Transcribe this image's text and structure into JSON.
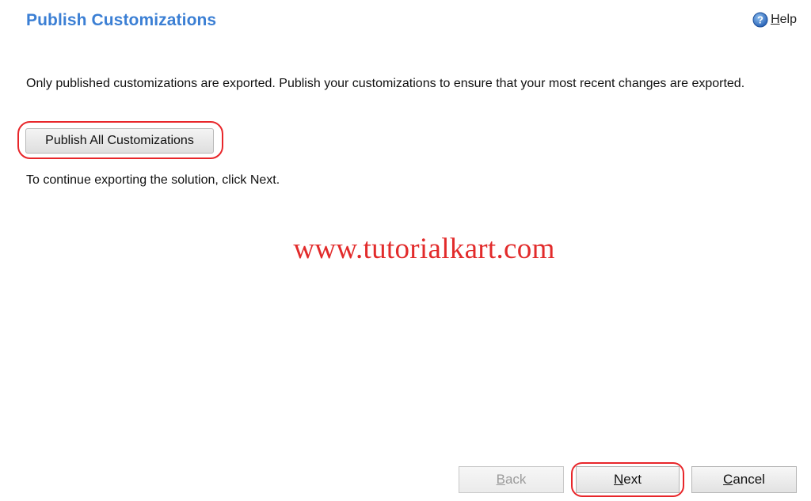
{
  "header": {
    "title": "Publish Customizations",
    "help_icon": "help-question-icon",
    "help_first_letter": "H",
    "help_rest": "elp"
  },
  "body": {
    "intro": "Only published customizations are exported. Publish your customizations to ensure that your most recent changes are exported.",
    "publish_button_label": "Publish All Customizations",
    "continue_text": "To continue exporting the solution, click Next."
  },
  "watermark": "www.tutorialkart.com",
  "footer": {
    "back_first_letter": "B",
    "back_rest": "ack",
    "next_first_letter": "N",
    "next_rest": "ext",
    "cancel_first_letter": "C",
    "cancel_rest": "ancel"
  },
  "colors": {
    "title": "#3b7fd4",
    "highlight": "#e8262a",
    "watermark": "#e22b2b"
  }
}
